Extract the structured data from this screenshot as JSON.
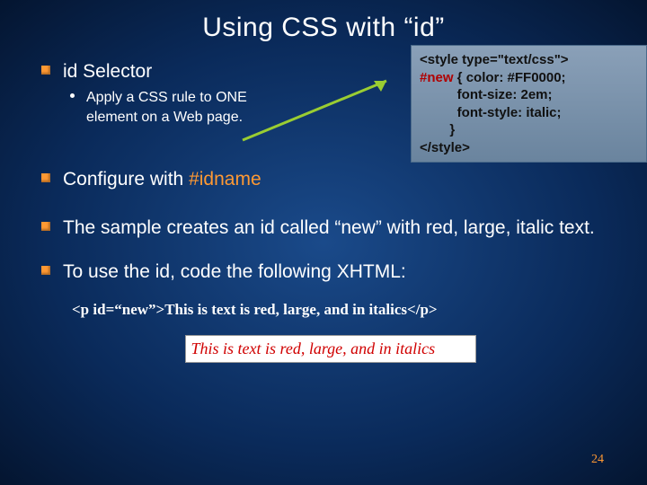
{
  "title": "Using CSS with “id”",
  "items": [
    {
      "text": "id Selector",
      "sub": [
        "Apply a CSS rule to ONE element on a Web page."
      ]
    },
    {
      "text_parts": [
        "Configure with ",
        "#idname"
      ]
    },
    {
      "text": "The sample creates an id called “new” with red, large, italic text."
    },
    {
      "text": "To use the id, code the following XHTML:"
    }
  ],
  "codebox": {
    "l1": "<style type=\"text/css\">",
    "l2a": "#new",
    "l2b": " { color: #FF0000;",
    "l3": "          font-size: 2em;",
    "l4": "          font-style: italic;",
    "l5": "        }",
    "l6": "</style>"
  },
  "example": "<p id=“new”>This is text is red, large, and in italics</p>",
  "render": "This is text is red, large, and in italics",
  "pagenum": "24"
}
